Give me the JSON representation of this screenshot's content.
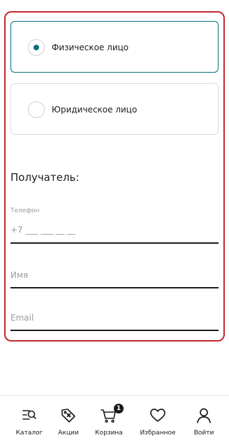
{
  "customer_type": {
    "options": [
      {
        "label": "Физическое лицо",
        "selected": true
      },
      {
        "label": "Юридическое лицо",
        "selected": false
      }
    ]
  },
  "recipient": {
    "title": "Получатель:",
    "phone": {
      "label": "Телефон",
      "placeholder": "+7 ___ ___ __ __"
    },
    "name": {
      "placeholder": "Имя"
    },
    "email": {
      "placeholder": "Email"
    }
  },
  "tabbar": {
    "items": [
      {
        "label": "Каталог",
        "icon": "catalog-icon"
      },
      {
        "label": "Акции",
        "icon": "discount-tag-icon"
      },
      {
        "label": "Корзина",
        "icon": "cart-icon",
        "badge": "1"
      },
      {
        "label": "Избранное",
        "icon": "heart-icon"
      },
      {
        "label": "Войти",
        "icon": "user-icon"
      }
    ]
  },
  "colors": {
    "accent": "#006f7d",
    "frame": "#c2272d",
    "text": "#1a1a1a",
    "muted": "#9a9a9a"
  }
}
